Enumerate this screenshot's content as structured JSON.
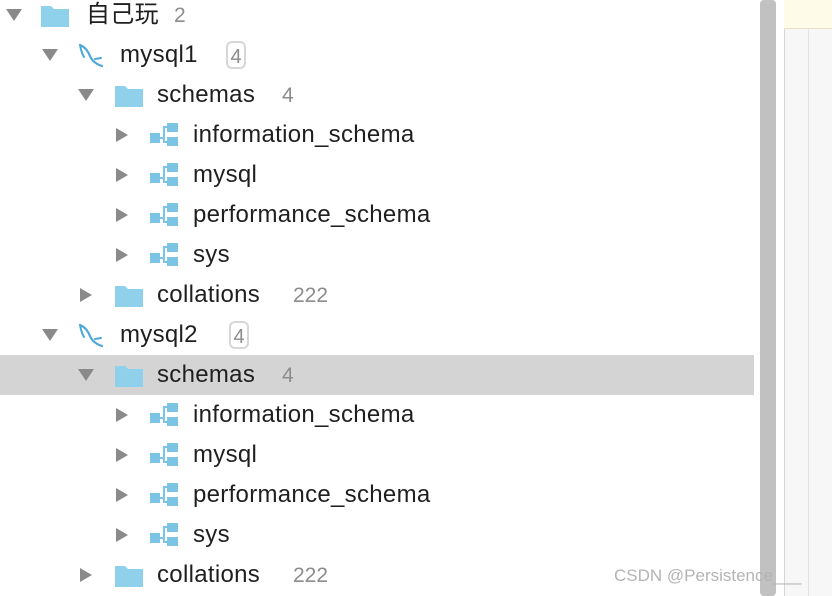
{
  "colors": {
    "folder": "#8fd0ea",
    "schema": "#7cc4e3",
    "dolphin": "#4aa8d8",
    "selected_row": "#d4d4d4"
  },
  "tree": {
    "root": {
      "label": "自己玩",
      "count": "2",
      "icon": "folder-icon"
    },
    "connections": [
      {
        "label": "mysql1",
        "badge": "4",
        "icon": "mysql-dolphin-icon",
        "schemas_folder": {
          "label": "schemas",
          "count": "4"
        },
        "schemas": [
          "information_schema",
          "mysql",
          "performance_schema",
          "sys"
        ],
        "collations_folder": {
          "label": "collations",
          "count": "222"
        }
      },
      {
        "label": "mysql2",
        "badge": "4",
        "icon": "mysql-dolphin-icon",
        "schemas_folder": {
          "label": "schemas",
          "count": "4",
          "selected": true
        },
        "schemas": [
          "information_schema",
          "mysql",
          "performance_schema",
          "sys"
        ],
        "collations_folder": {
          "label": "collations",
          "count": "222"
        }
      }
    ]
  },
  "watermark": "CSDN @Persistence___"
}
